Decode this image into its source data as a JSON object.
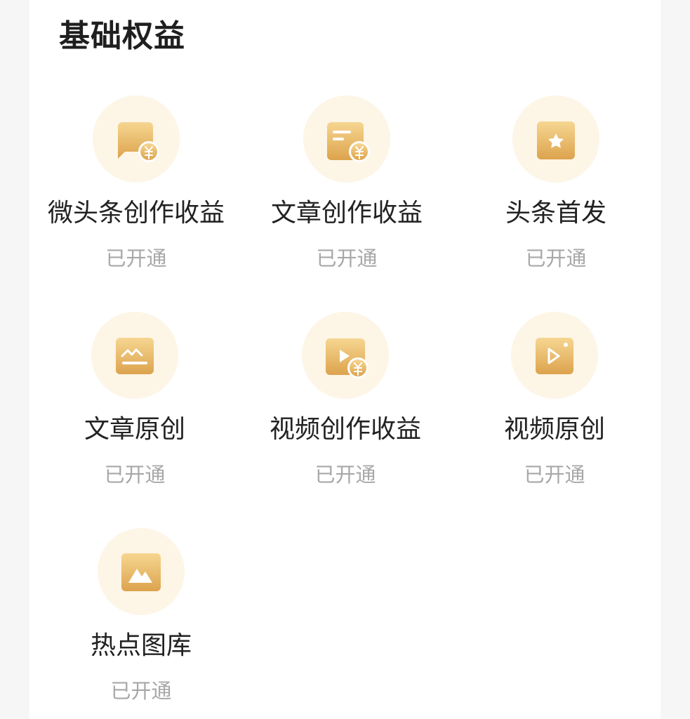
{
  "section": {
    "title": "基础权益"
  },
  "benefits": [
    {
      "label": "微头条创作收益",
      "status": "已开通",
      "icon": "chat-bubble-yuan-icon"
    },
    {
      "label": "文章创作收益",
      "status": "已开通",
      "icon": "document-yuan-icon"
    },
    {
      "label": "头条首发",
      "status": "已开通",
      "icon": "star-badge-icon"
    },
    {
      "label": "文章原创",
      "status": "已开通",
      "icon": "line-chart-icon"
    },
    {
      "label": "视频创作收益",
      "status": "已开通",
      "icon": "play-yuan-icon"
    },
    {
      "label": "视频原创",
      "status": "已开通",
      "icon": "video-play-icon"
    },
    {
      "label": "热点图库",
      "status": "已开通",
      "icon": "mountain-image-icon"
    }
  ],
  "colors": {
    "icon_gradient_top": "#f6d691",
    "icon_gradient_bottom": "#dca34d",
    "icon_circle_bg": "#fdf5e6",
    "status_text": "#a8a8a8",
    "label_text": "#222222",
    "title_text": "#1f1f1f"
  }
}
